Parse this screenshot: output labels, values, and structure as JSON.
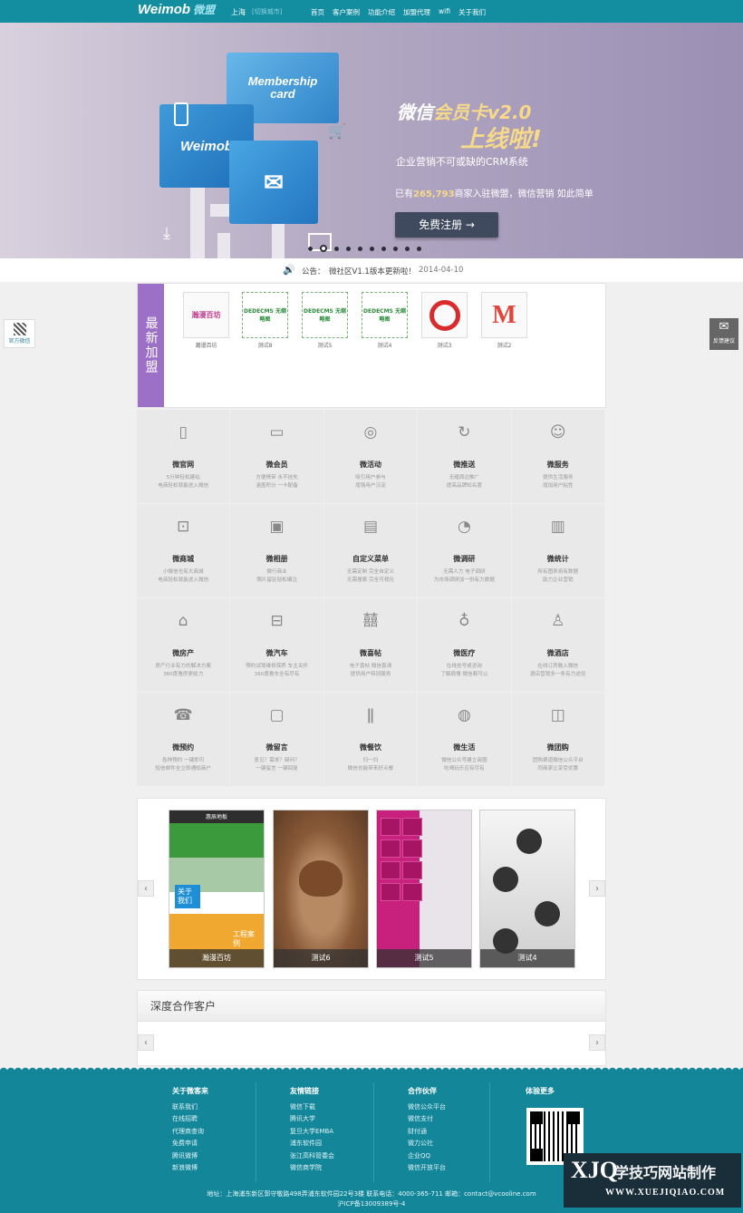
{
  "header": {
    "logo": "Weimob",
    "logo_cn": "微盟",
    "city": "上海",
    "city_switch": "[切换城市]",
    "nav": [
      "首页",
      "客户案例",
      "功能介绍",
      "加盟代理",
      "wifi",
      "关于我们"
    ]
  },
  "banner": {
    "card_weimob": "Weimob",
    "card_member_1": "Membership",
    "card_member_2": "card",
    "title_prefix": "微信",
    "title_main": "会员卡",
    "title_version": "v2.0",
    "title_line2": "上线啦!",
    "subtitle": "企业营销不可或缺的CRM系统",
    "count_prefix": "已有",
    "count_value": "265,793",
    "count_suffix": "商家入驻微盟，微信营销 如此简单",
    "register_button": "免费注册 →",
    "slide_count": 10,
    "active_slide": 1
  },
  "notice": {
    "label": "公告：",
    "text": "微社区V1.1版本更新啦！",
    "date": "2014-04-10"
  },
  "side": {
    "left_label": "官方微信",
    "right_label": "反馈建议"
  },
  "joined": {
    "label": "最新加盟",
    "partners": [
      {
        "logo": "瀚漫百坊",
        "name": "瀚漫百坊"
      },
      {
        "logo": "DEDECMS 无缩略图",
        "name": "测试8"
      },
      {
        "logo": "DEDECMS 无缩略图",
        "name": "测试5"
      },
      {
        "logo": "DEDECMS 无缩略图",
        "name": "测试4"
      },
      {
        "logo": "",
        "name": "测试3"
      },
      {
        "logo": "M",
        "name": "测试2"
      }
    ]
  },
  "features": [
    {
      "icon": "phone-icon",
      "glyph": "▯",
      "title": "微官网",
      "d1": "5分钟轻松建站",
      "d2": "电商轻松就能进入微信"
    },
    {
      "icon": "card-icon",
      "glyph": "▭",
      "title": "微会员",
      "d1": "方便携带 永不挂失",
      "d2": "涵盖积分 一卡配备"
    },
    {
      "icon": "activity-icon",
      "glyph": "◎",
      "title": "微活动",
      "d1": "吸引用户参与",
      "d2": "增强用户沉淀"
    },
    {
      "icon": "push-icon",
      "glyph": "↻",
      "title": "微推送",
      "d1": "无缝周边推广",
      "d2": "提高品牌知名度"
    },
    {
      "icon": "service-icon",
      "glyph": "☺",
      "title": "微服务",
      "d1": "提供生活服务",
      "d2": "增加用户粘性"
    },
    {
      "icon": "cart-icon",
      "glyph": "⊡",
      "title": "微商城",
      "d1": "小微信也有大商城",
      "d2": "电商轻松就能进入微信"
    },
    {
      "icon": "album-icon",
      "glyph": "▣",
      "title": "微相册",
      "d1": "微行商业",
      "d2": "照片留驻轻松编注"
    },
    {
      "icon": "menu-icon",
      "glyph": "▤",
      "title": "自定义菜单",
      "d1": "无需定制 完全自定义",
      "d2": "无需搜索 完全可视化"
    },
    {
      "icon": "survey-icon",
      "glyph": "◔",
      "title": "微调研",
      "d1": "无需人力 电子调研",
      "d2": "为市场调研加一份有力数据"
    },
    {
      "icon": "stats-icon",
      "glyph": "▥",
      "title": "微统计",
      "d1": "所有图表将有数据",
      "d2": "助力企业营销"
    },
    {
      "icon": "house-icon",
      "glyph": "⌂",
      "title": "微房产",
      "d1": "房产行业有力的解决方案",
      "d2": "360度看房更给力"
    },
    {
      "icon": "car-icon",
      "glyph": "⊟",
      "title": "微汽车",
      "d1": "预约试驾维修保养 车主关怀",
      "d2": "360度看车全有尽有"
    },
    {
      "icon": "wedding-icon",
      "glyph": "囍",
      "title": "微喜帖",
      "d1": "电子喜帖 微信喜请",
      "d2": "提供用户特别服务"
    },
    {
      "icon": "stethoscope-icon",
      "glyph": "♁",
      "title": "微医疗",
      "d1": "在线挂号或咨询",
      "d2": "了解病情 微信都可以"
    },
    {
      "icon": "lamp-icon",
      "glyph": "♙",
      "title": "微酒店",
      "d1": "在线订房融入微信",
      "d2": "酒店营销多一条有力途径"
    },
    {
      "icon": "telephone-icon",
      "glyph": "☎",
      "title": "微预约",
      "d1": "各种预约 一键即可",
      "d2": "短信邮件全立即通知商户"
    },
    {
      "icon": "message-icon",
      "glyph": "▢",
      "title": "微留言",
      "d1": "意见？需求？疑问？",
      "d2": "一键留言 一键回复"
    },
    {
      "icon": "dining-icon",
      "glyph": "ǁ",
      "title": "微餐饮",
      "d1": "扫一扫",
      "d2": "微信也能带来好点餐"
    },
    {
      "icon": "planet-icon",
      "glyph": "◍",
      "title": "微生活",
      "d1": "微信公众号建立商圈",
      "d2": "吃喝玩乐应有尽有"
    },
    {
      "icon": "groupbuy-icon",
      "glyph": "◫",
      "title": "微团购",
      "d1": "团购渠道微信公众平台",
      "d2": "同商家让享受优惠"
    }
  ],
  "showcase": {
    "cases": [
      "瀚漫百坊",
      "测试6",
      "测试5",
      "测试4"
    ],
    "case1_top": "惠辰地板",
    "case1_tag": "关于我们",
    "case1_tag2": "工程案例"
  },
  "clients": {
    "title": "深度合作客户"
  },
  "footer": {
    "columns": [
      {
        "title": "关于微客来",
        "items": [
          "联系我们",
          "在线招聘",
          "代理商查询",
          "免费申请",
          "腾讯微博",
          "新浪微博"
        ]
      },
      {
        "title": "友情链接",
        "items": [
          "微信下载",
          "腾讯大学",
          "复旦大学EMBA",
          "浦东软件园",
          "张江高科管委会",
          "微信商学院"
        ]
      },
      {
        "title": "合作伙伴",
        "items": [
          "微信公众平台",
          "微信支付",
          "财付通",
          "微力公社",
          "企业QQ",
          "微信开放平台"
        ]
      },
      {
        "title": "体验更多",
        "items": []
      }
    ],
    "address": "地址：上海浦东新区郭守敬路498弄浦东软件园22号3楼 联系电话：4000-365-711 邮箱：contact@vcooline.com",
    "icp": "沪ICP备13009389号-4"
  },
  "watermark": {
    "xj": "XJQ",
    "cn": "学技巧网站制作",
    "url": "WWW.XUEJIQIAO.COM"
  }
}
